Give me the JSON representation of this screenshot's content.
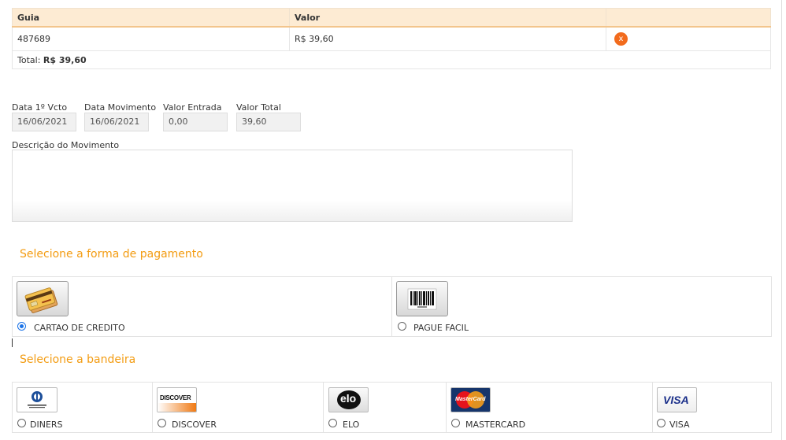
{
  "table": {
    "headers": [
      "Guia",
      "Valor",
      ""
    ],
    "rows": [
      {
        "guia": "487689",
        "valor": "R$ 39,60"
      }
    ],
    "total_label": "Total:",
    "total_value": "R$ 39,60",
    "remove_glyph": "x"
  },
  "fields": {
    "data_vcto": {
      "label": "Data 1º Vcto",
      "value": "16/06/2021"
    },
    "data_mov": {
      "label": "Data Movimento",
      "value": "16/06/2021"
    },
    "valor_entrada": {
      "label": "Valor Entrada",
      "value": "0,00"
    },
    "valor_total": {
      "label": "Valor Total",
      "value": "39,60"
    },
    "descricao": {
      "label": "Descrição do Movimento",
      "value": ""
    }
  },
  "payment": {
    "title": "Selecione a forma de pagamento",
    "options": [
      {
        "label": "CARTAO DE CREDITO",
        "icon": "credit-card-icon",
        "selected": true
      },
      {
        "label": "PAGUE FACIL",
        "icon": "barcode-icon",
        "selected": false
      }
    ]
  },
  "brand": {
    "title": "Selecione a bandeira",
    "options": [
      {
        "label": "DINERS",
        "icon": "diners-club-logo"
      },
      {
        "label": "DISCOVER",
        "icon": "discover-logo",
        "logo_text": "DISCOVER"
      },
      {
        "label": "ELO",
        "icon": "elo-logo",
        "logo_text": "elo"
      },
      {
        "label": "MASTERCARD",
        "icon": "mastercard-logo",
        "logo_text": "MasterCard"
      },
      {
        "label": "VISA",
        "icon": "visa-logo",
        "logo_text": "VISA"
      }
    ]
  },
  "colors": {
    "accent": "#f39c12",
    "header_bg": "#fdebd3",
    "remove": "#f26b1d"
  }
}
